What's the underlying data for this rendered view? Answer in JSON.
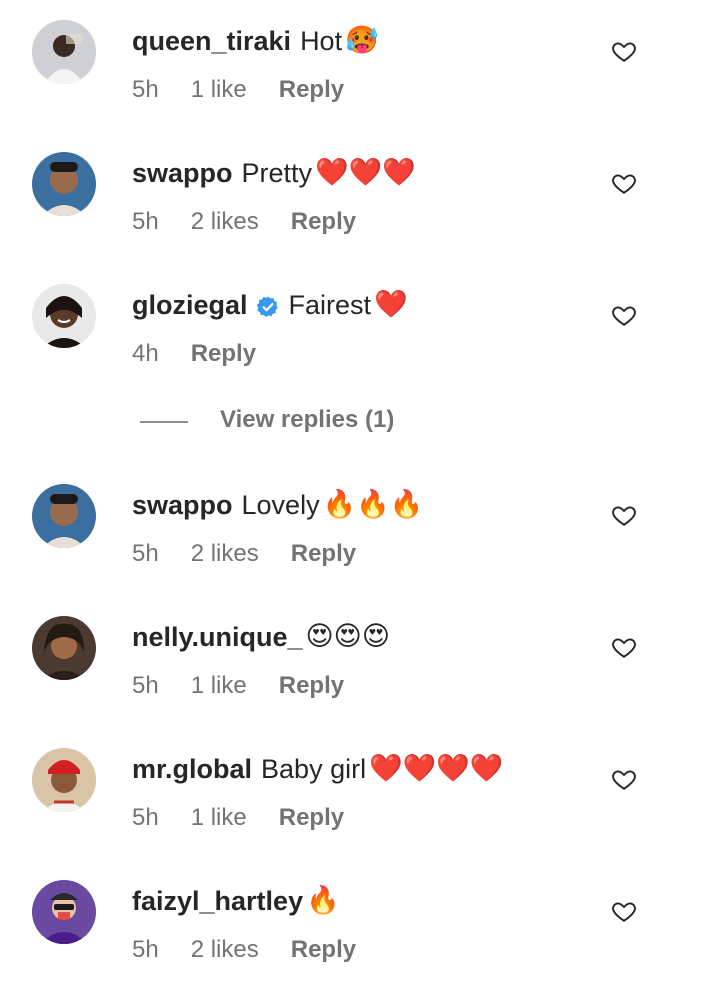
{
  "comments": [
    {
      "username": "queen_tiraki",
      "text": "Hot",
      "emoji": "🥵",
      "time": "5h",
      "likes": "1 like",
      "reply_label": "Reply",
      "verified": false,
      "avatar": "avatar-1"
    },
    {
      "username": "swappo",
      "text": "Pretty",
      "emoji": "❤️❤️❤️",
      "time": "5h",
      "likes": "2 likes",
      "reply_label": "Reply",
      "verified": false,
      "avatar": "avatar-2"
    },
    {
      "username": "gloziegal",
      "text": "Fairest",
      "emoji": "❤️",
      "time": "4h",
      "likes": "",
      "reply_label": "Reply",
      "verified": true,
      "avatar": "avatar-3"
    },
    {
      "username": "swappo",
      "text": "Lovely",
      "emoji": "🔥🔥🔥",
      "time": "5h",
      "likes": "2 likes",
      "reply_label": "Reply",
      "verified": false,
      "avatar": "avatar-2"
    },
    {
      "username": "nelly.unique_",
      "text": "",
      "emoji": "😍😍😍",
      "time": "5h",
      "likes": "1 like",
      "reply_label": "Reply",
      "verified": false,
      "avatar": "avatar-4"
    },
    {
      "username": "mr.global",
      "text": "Baby girl",
      "emoji": "❤️❤️❤️❤️",
      "time": "5h",
      "likes": "1 like",
      "reply_label": "Reply",
      "verified": false,
      "avatar": "avatar-5"
    },
    {
      "username": "faizyl_hartley",
      "text": "",
      "emoji": "🔥",
      "time": "5h",
      "likes": "2 likes",
      "reply_label": "Reply",
      "verified": false,
      "avatar": "avatar-6"
    }
  ],
  "view_replies": {
    "label": "View replies (1)"
  },
  "icons": {
    "like": "heart-outline-icon",
    "verified": "verified-badge-icon"
  },
  "colors": {
    "text": "#262626",
    "meta": "#737373",
    "verified": "#3897f0",
    "heart": "#ed2b3b"
  }
}
